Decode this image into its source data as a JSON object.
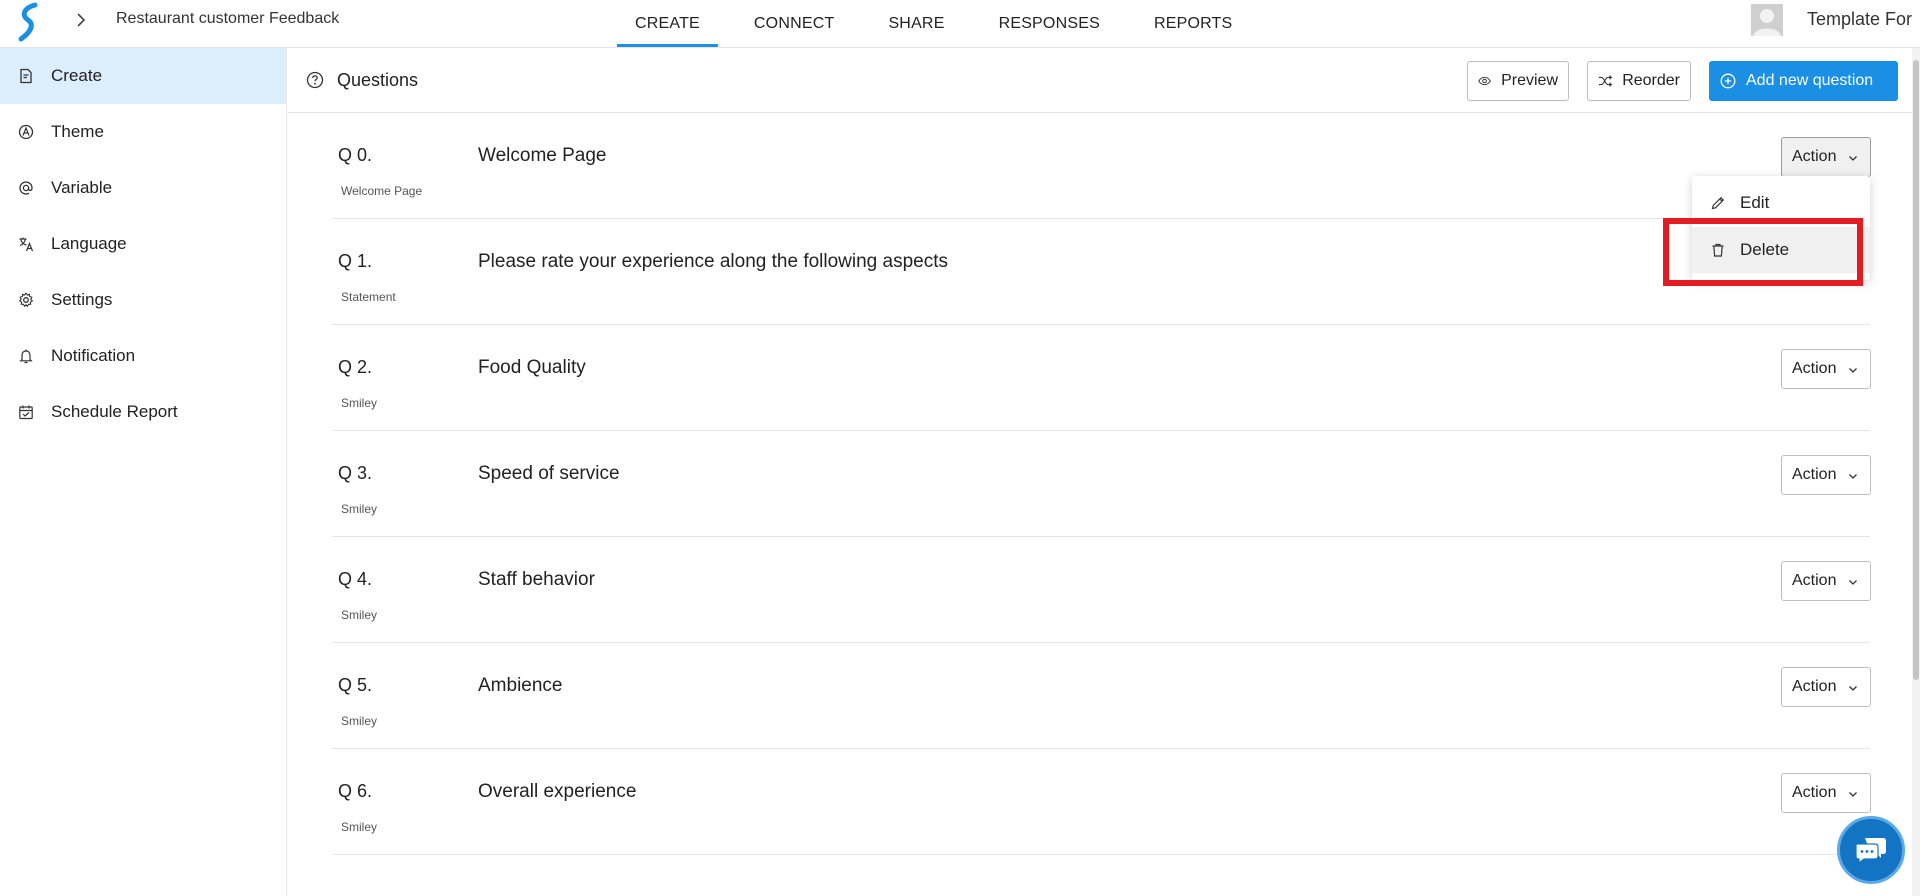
{
  "app": {
    "logo_icon": "app-logo-icon",
    "form_title": "Restaurant customer Feedback"
  },
  "top_tabs": [
    {
      "label": "CREATE",
      "active": true
    },
    {
      "label": "CONNECT",
      "active": false
    },
    {
      "label": "SHARE",
      "active": false
    },
    {
      "label": "RESPONSES",
      "active": false
    },
    {
      "label": "REPORTS",
      "active": false
    }
  ],
  "account": {
    "name": "Template For",
    "avatar_icon": "avatar-icon"
  },
  "sidebar": {
    "items": [
      {
        "label": "Create",
        "icon": "create-form-icon",
        "active": true
      },
      {
        "label": "Theme",
        "icon": "theme-icon",
        "active": false
      },
      {
        "label": "Variable",
        "icon": "at-icon",
        "active": false
      },
      {
        "label": "Language",
        "icon": "translate-icon",
        "active": false
      },
      {
        "label": "Settings",
        "icon": "gear-icon",
        "active": false
      },
      {
        "label": "Notification",
        "icon": "bell-icon",
        "active": false
      },
      {
        "label": "Schedule Report",
        "icon": "calendar-icon",
        "active": false
      }
    ]
  },
  "questions_header": {
    "title": "Questions",
    "preview_label": "Preview",
    "reorder_label": "Reorder",
    "add_label": "Add new question"
  },
  "questions": [
    {
      "number": "Q 0.",
      "type": "Welcome Page",
      "text": "Welcome Page"
    },
    {
      "number": "Q 1.",
      "type": "Statement",
      "text": "Please rate your experience along the following aspects"
    },
    {
      "number": "Q 2.",
      "type": "Smiley",
      "text": "Food Quality"
    },
    {
      "number": "Q 3.",
      "type": "Smiley",
      "text": "Speed of service"
    },
    {
      "number": "Q 4.",
      "type": "Smiley",
      "text": "Staff behavior"
    },
    {
      "number": "Q 5.",
      "type": "Smiley",
      "text": "Ambience"
    },
    {
      "number": "Q 6.",
      "type": "Smiley",
      "text": "Overall experience"
    }
  ],
  "action_label": "Action",
  "action_menu": {
    "edit_label": "Edit",
    "delete_label": "Delete"
  },
  "colors": {
    "accent": "#1a8fe3",
    "highlight": "#e31b23",
    "sidebar_active": "#dcedfc",
    "chat": "#1474c4"
  }
}
